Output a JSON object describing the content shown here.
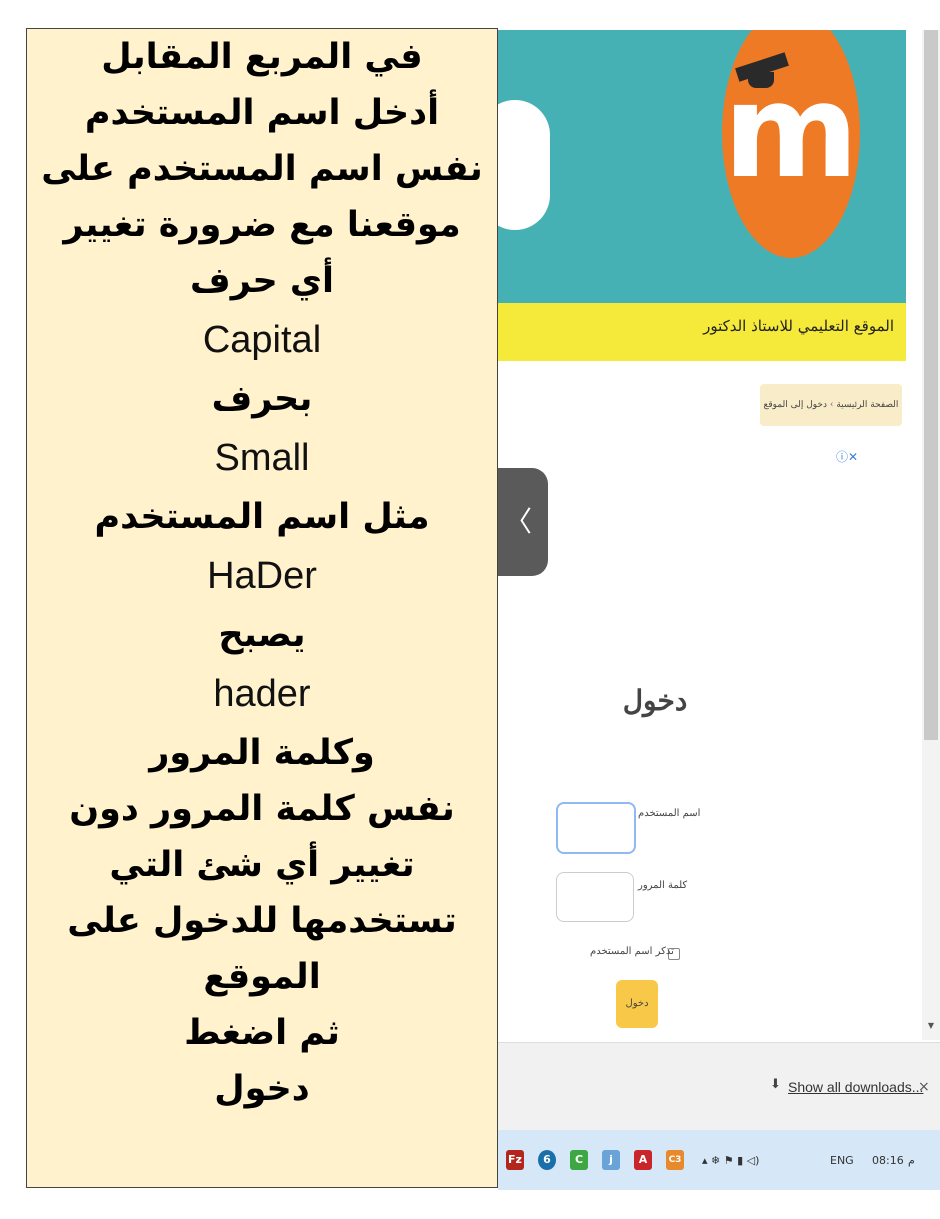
{
  "instructions": {
    "lines": [
      "في المربع المقابل",
      "أدخل اسم المستخدم",
      "نفس اسم المستخدم على",
      "موقعنا مع ضرورة تغيير",
      "أي حرف",
      "Capital",
      "بحرف",
      "Small",
      "مثل اسم المستخدم",
      "HaDer",
      "يصبح",
      "hader",
      "وكلمة المرور",
      "نفس كلمة المرور دون",
      "تغيير أي شئ التي",
      "تستخدمها للدخول على",
      "الموقع",
      "ثم اضغط",
      "دخول"
    ]
  },
  "site": {
    "title": "الموقع التعليمي للاستاذ الدكتور",
    "logo_letter": "m",
    "breadcrumb": {
      "home": "الصفحة الرئيسية",
      "separator": "›",
      "current": "دخول إلى الموقع"
    },
    "ad_choices": "ⓘ✕",
    "side_tab_icon": "chevron-left-icon",
    "login": {
      "heading": "دخول",
      "username_label": "اسم المستخدم",
      "password_label": "كلمة المرور",
      "remember_label": "تذكر اسم المستخدم",
      "button": "دخول"
    }
  },
  "downloads": {
    "link": "Show all downloads...",
    "close": "×"
  },
  "taskbar": {
    "apps": [
      "Fz",
      "6",
      "C",
      "j",
      "A",
      "C3"
    ],
    "tray_lang": "ENG",
    "clock": "08:16",
    "clock_suffix": "م"
  },
  "colors": {
    "panel": "#fff2cc",
    "hero": "#46b1b4",
    "logo": "#ee7a26",
    "site_bar": "#f5e93a",
    "login_button": "#f8c948"
  }
}
